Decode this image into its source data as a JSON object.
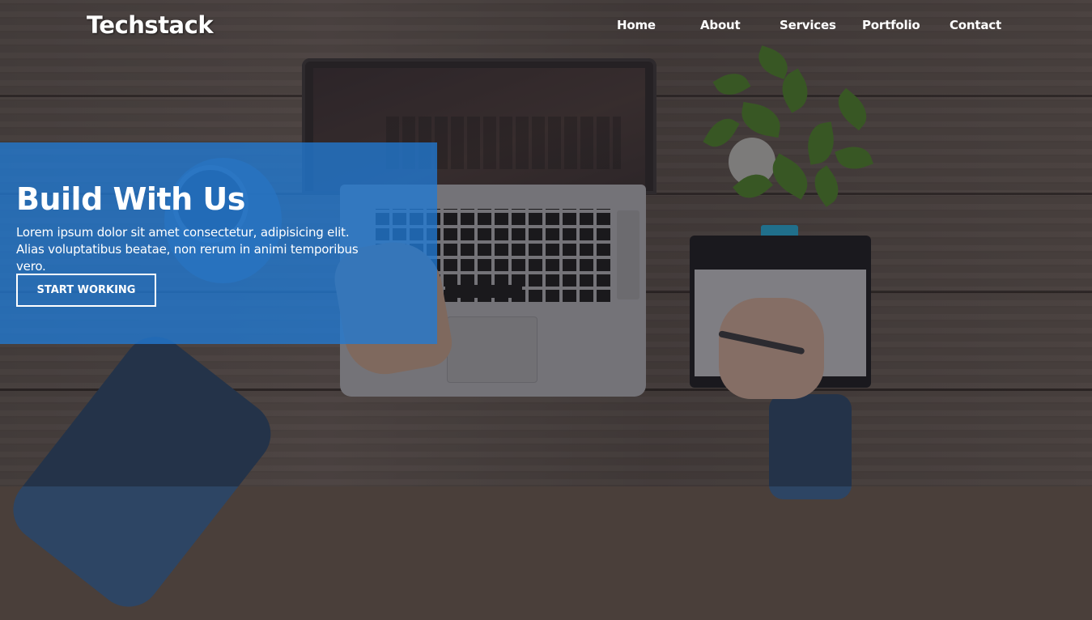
{
  "header": {
    "brand": "Techstack",
    "nav": [
      {
        "label": "Home"
      },
      {
        "label": "About"
      },
      {
        "label": "Services"
      },
      {
        "label": "Portfolio"
      },
      {
        "label": "Contact"
      }
    ]
  },
  "hero": {
    "title": "Build With Us",
    "text": "Lorem ipsum dolor sit amet consectetur, adipisicing elit. Alias voluptatibus beatae, non rerum in animi temporibus vero.",
    "cta_label": "START WORKING"
  },
  "colors": {
    "hero_overlay": "#217ad4",
    "text": "#ffffff"
  }
}
